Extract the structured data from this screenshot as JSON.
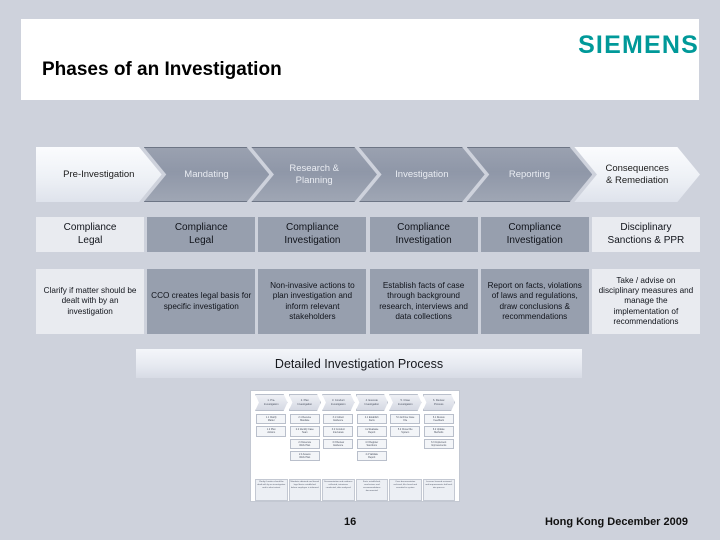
{
  "header": {
    "title": "Phases of an Investigation",
    "brand": "SIEMENS",
    "brand_color": "#009999"
  },
  "background_color": "#ced2dc",
  "phases": [
    {
      "name": "Pre-Investigation",
      "highlight": true,
      "owner": "Compliance\nLegal",
      "owner_highlight": true,
      "desc": "Clarify if matter should be dealt with by an investigation",
      "desc_highlight": true
    },
    {
      "name": "Mandating",
      "highlight": false,
      "owner": "Compliance\nLegal",
      "owner_highlight": false,
      "desc": "CCO creates legal basis for specific investigation",
      "desc_highlight": false
    },
    {
      "name": "Research &\nPlanning",
      "highlight": false,
      "owner": "Compliance\nInvestigation",
      "owner_highlight": false,
      "desc": "Non-invasive actions to plan investigation and inform relevant stakeholders",
      "desc_highlight": false
    },
    {
      "name": "Investigation",
      "highlight": false,
      "owner": "Compliance\nInvestigation",
      "owner_highlight": false,
      "desc": "Establish facts of case through background research, interviews and data collections",
      "desc_highlight": false
    },
    {
      "name": "Reporting",
      "highlight": false,
      "owner": "Compliance\nInvestigation",
      "owner_highlight": false,
      "desc": "Report on facts, violations of laws and regulations, draw conclusions & recommendations",
      "desc_highlight": false
    },
    {
      "name": "Consequences\n& Remediation",
      "highlight": true,
      "owner": "Disciplinary\nSanctions & PPR",
      "owner_highlight": true,
      "desc": "Take / advise on disciplinary measures and manage the implementation of recommendations",
      "desc_highlight": true
    }
  ],
  "detail_band": {
    "label": "Detailed Investigation Process"
  },
  "thumbnail": {
    "alt": "detailed-investigation-process-thumbnail",
    "columns": 6,
    "phase_labels": [
      "1. Pre-\nInvestigation",
      "2. Plan\nInvestigation",
      "3. Conduct\nInvestigation",
      "4. Execute\nInvestigation",
      "5. Close\nInvestigation",
      "6. Review\nProcess"
    ],
    "col_boxes": [
      [
        "1.1 Clarify\nMatter",
        "1.2 Plan\nActions"
      ],
      [
        "2.1 Receive\nMandate",
        "2.2 Identify Case\nTeam",
        "2.3 Execute\nWork Plan",
        "2.4 Assess\nWork Plan"
      ],
      [
        "3.1 Collect\nEvidence",
        "3.2 Conduct\nInterviews",
        "3.3 Review\nEvidence"
      ],
      [
        "4.1 Establish\nFacts",
        "4.2 Evaluate\nReport",
        "4.3 Register\nSanctions",
        "4.4 Validate\nReport"
      ],
      [
        "5.1 Archive Case\nFile",
        "5.2 Close File\nSystem"
      ],
      [
        "6.1 Review\nFeedback",
        "6.2 Update\nMethods",
        "6.3 Implement\nImprovements"
      ]
    ],
    "notes": [
      "Clarify if matter should be dealt with by an investigation and to what extent",
      "Mandate obtained and formal legal basis established before employee is informed",
      "Documentation and evidence collected, interviews conducted, data analysed",
      "Facts established, conclusions and recommendations documented",
      "Case documentation archived, file closed and recorded in system",
      "Lessons learned reviewed and improvements fed back into process"
    ]
  },
  "footer": {
    "page_number": "16",
    "right_text": "Hong Kong December 2009"
  }
}
